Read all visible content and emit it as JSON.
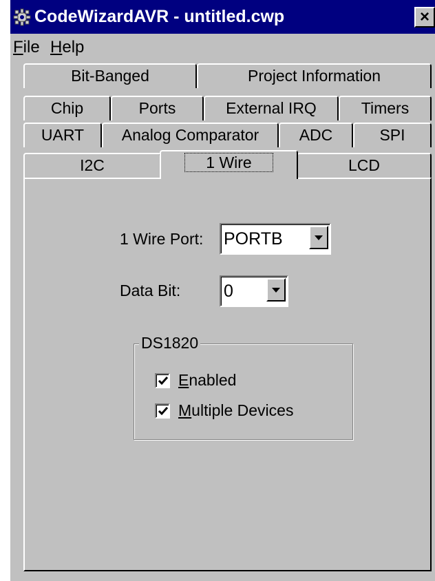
{
  "window": {
    "title": "CodeWizardAVR - untitled.cwp",
    "close_glyph": "×"
  },
  "menu": {
    "file": {
      "accel": "F",
      "rest": "ile"
    },
    "help": {
      "accel": "H",
      "rest": "elp"
    }
  },
  "tabs": {
    "bit_banged": "Bit-Banged",
    "project_information": "Project Information",
    "chip": "Chip",
    "ports": "Ports",
    "external_irq": "External IRQ",
    "timers": "Timers",
    "uart": "UART",
    "analog_comparator": "Analog Comparator",
    "adc": "ADC",
    "spi": "SPI",
    "i2c": "I2C",
    "one_wire": "1 Wire",
    "lcd": "LCD",
    "active": "1 Wire"
  },
  "one_wire_panel": {
    "port_label": "1 Wire Port:",
    "port_value": "PORTB",
    "data_bit_label": "Data Bit:",
    "data_bit_value": "0",
    "group_title": "DS1820",
    "enabled": {
      "accel": "E",
      "rest": "nabled",
      "checked": true
    },
    "multiple_devices": {
      "accel": "M",
      "rest": "ultiple Devices",
      "checked": true
    }
  }
}
